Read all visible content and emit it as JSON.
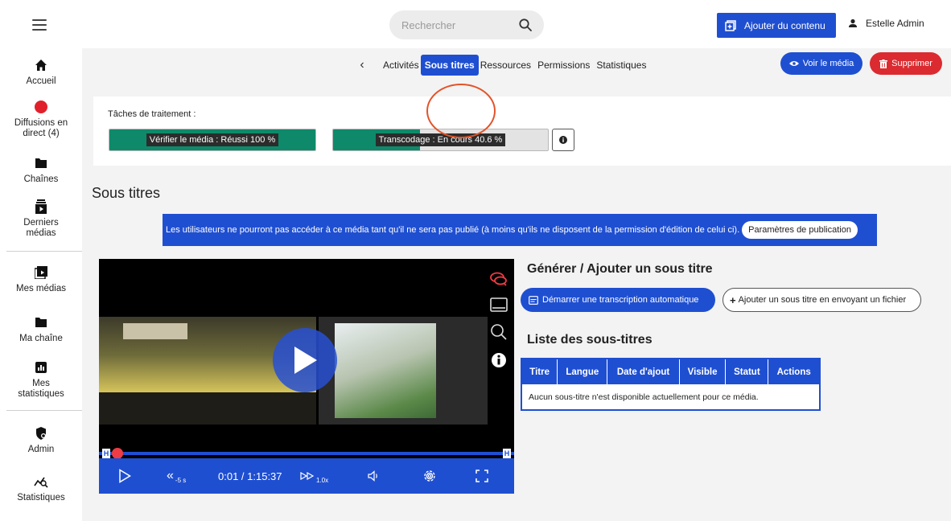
{
  "header": {
    "search_placeholder": "Rechercher",
    "add_content_label": "Ajouter du contenu",
    "user_name": "Estelle Admin"
  },
  "sidebar": {
    "items": [
      {
        "label": "Accueil",
        "icon": "home-icon"
      },
      {
        "label": "Diffusions en direct (4)",
        "icon": "live-dot-icon"
      },
      {
        "label": "Chaînes",
        "icon": "folder-icon"
      },
      {
        "label": "Derniers médias",
        "icon": "latest-media-icon"
      },
      {
        "label": "Mes médias",
        "icon": "my-media-icon"
      },
      {
        "label": "Ma chaîne",
        "icon": "folder-icon"
      },
      {
        "label": "Mes statistiques",
        "icon": "stats-icon"
      },
      {
        "label": "Admin",
        "icon": "admin-icon"
      },
      {
        "label": "Statistiques",
        "icon": "statistics-icon"
      }
    ]
  },
  "tabs": {
    "items": [
      "Activités",
      "Sous titres",
      "Ressources",
      "Permissions",
      "Statistiques"
    ],
    "active": "Sous titres"
  },
  "actions": {
    "view_label": "Voir le média",
    "delete_label": "Supprimer"
  },
  "tasks": {
    "title": "Tâches de traitement :",
    "items": [
      {
        "label": "Vérifier le média : Réussi 100 %",
        "progress": 100
      },
      {
        "label": "Transcodage : En cours 40.6 %",
        "progress": 40.6
      }
    ]
  },
  "section_title": "Sous titres",
  "banner": {
    "text": "Les utilisateurs ne pourront pas accéder à ce média tant qu'il ne sera pas publié (à moins qu'ils ne disposent de la permission d'édition de celui ci).",
    "button_label": "Paramètres de publication"
  },
  "player": {
    "time": "0:01 / 1:15:37",
    "rewind_label": "-5 s",
    "speed_label": "1.0x",
    "start_marker": "H",
    "end_marker": "H"
  },
  "generate": {
    "title": "Générer / Ajouter un sous titre",
    "auto_label": "Démarrer une transcription automatique",
    "file_label": "Ajouter un sous titre en envoyant un fichier"
  },
  "subtitles_list": {
    "title": "Liste des sous-titres",
    "columns": [
      "Titre",
      "Langue",
      "Date d'ajout",
      "Visible",
      "Statut",
      "Actions"
    ],
    "empty_message": "Aucun sous-titre n'est disponible actuellement pour ce média."
  },
  "colors": {
    "accent": "#1f4fd1",
    "danger": "#db2b30",
    "success": "#0e8a6a",
    "highlight": "#e3532a"
  }
}
